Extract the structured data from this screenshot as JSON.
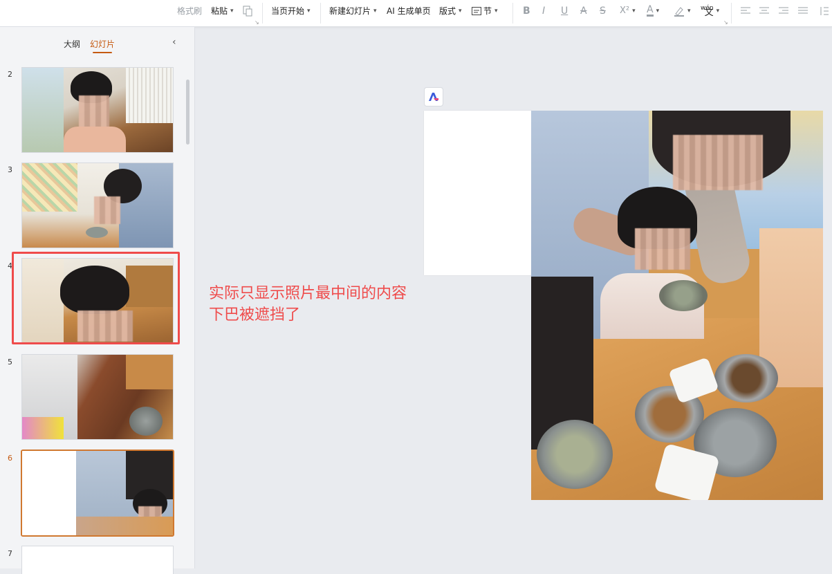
{
  "toolbar": {
    "format_painter": "格式刷",
    "paste": "粘贴",
    "start_from_current": "当页开始",
    "new_slide": "新建幻灯片",
    "ai_generate": "AI 生成单页",
    "layout": "版式",
    "section": "节",
    "font_bold": "B",
    "font_italic": "I",
    "font_underline": "U",
    "font_strike_a": "A",
    "font_strike_s": "S",
    "superscript": "X²",
    "font_color": "A",
    "pinyin": "wén"
  },
  "left_panel": {
    "tab_outline": "大纲",
    "tab_slides": "幻灯片",
    "slides": [
      {
        "number": "2"
      },
      {
        "number": "3"
      },
      {
        "number": "4"
      },
      {
        "number": "5"
      },
      {
        "number": "6"
      },
      {
        "number": "7"
      }
    ]
  },
  "annotation": {
    "line1": "实际只显示照片最中间的内容",
    "line2": "下巴被遮挡了"
  },
  "colors": {
    "accent": "#c55a11",
    "annotation_red": "#ef4b4b"
  }
}
